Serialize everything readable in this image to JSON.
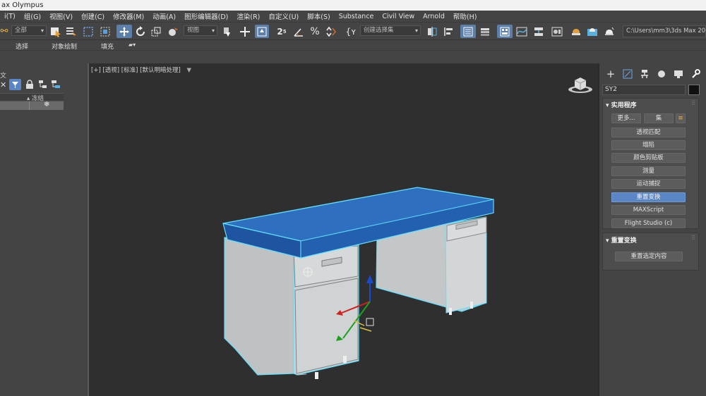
{
  "window": {
    "title": "ax Olympus"
  },
  "menu": [
    "i(T)",
    "组(G)",
    "视图(V)",
    "创建(C)",
    "修改器(M)",
    "动画(A)",
    "图形编辑器(D)",
    "渲染(R)",
    "自定义(U)",
    "脚本(S)",
    "Substance",
    "Civil View",
    "Arnold",
    "帮助(H)"
  ],
  "toolbar": {
    "filter_select": "全部",
    "ref_coord_select": "视图",
    "named_selection_select": "创建选择集",
    "project_path": "C:\\Users\\mm3\\3ds Max 2024"
  },
  "ribbon": {
    "tabs": [
      "选择",
      "对象绘制",
      "填充"
    ]
  },
  "scene_explorer": {
    "column_header": "▴ 冻结"
  },
  "viewport": {
    "label": "[+] [透视] [标准] [默认明暗处理]"
  },
  "command_panel": {
    "object_name": "SY2",
    "swatch_color": "#111111",
    "utilities_rollout": {
      "title": "实用程序",
      "more_label": "更多...",
      "sets_label": "集",
      "items": [
        "透视匹配",
        "塌陷",
        "颜色剪贴板",
        "测量",
        "运动捕捉",
        "重置变换",
        "MAXScript",
        "Flight Studio (c)"
      ],
      "active_index": 5
    },
    "reset_xform_rollout": {
      "title": "重置变换",
      "button_label": "重置选定内容"
    }
  },
  "colors": {
    "viewport_bg": "#2f2f2f",
    "desk_top": "#2f6fc0",
    "desk_body": "#c9cccd",
    "selection_outline": "#5ee0ff",
    "accent": "#5b86c6"
  }
}
